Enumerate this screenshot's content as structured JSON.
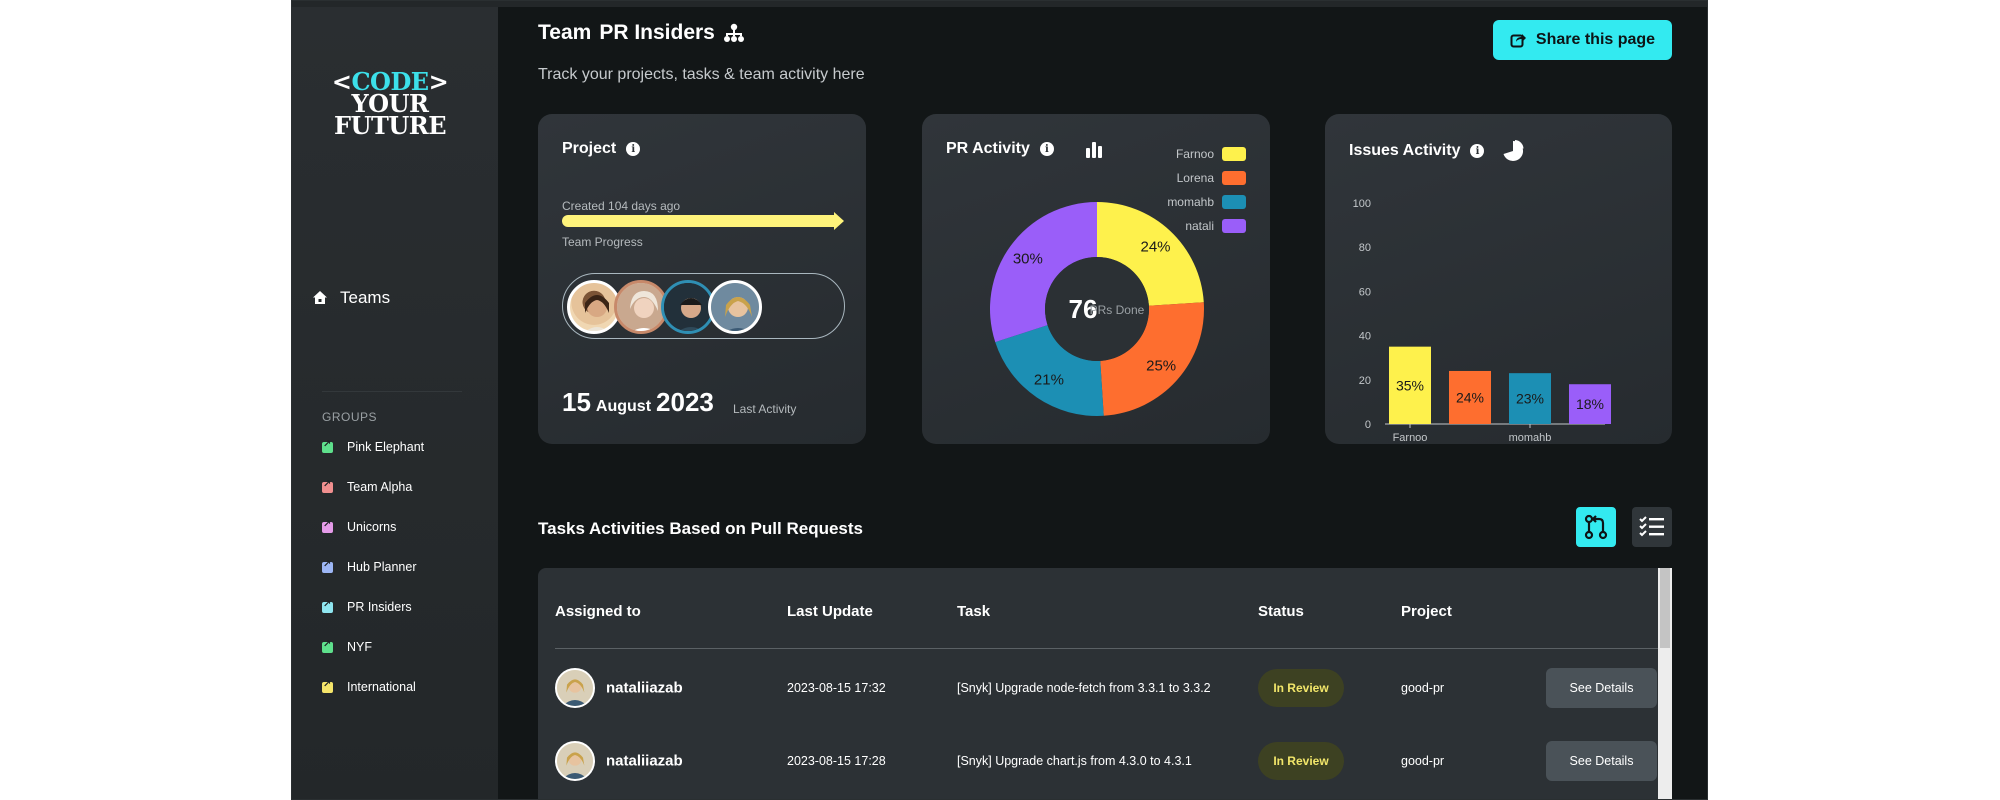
{
  "brand": {
    "logo_lt": "<",
    "logo_code": "CODE",
    "logo_gt": ">",
    "logo_your": "YOUR",
    "logo_future": "FUTURE"
  },
  "sidebar": {
    "teams_label": "Teams",
    "groups_title": "GROUPS",
    "groups": [
      {
        "label": "Pink Elephant",
        "color": "#5ee08c"
      },
      {
        "label": "Team Alpha",
        "color": "#f08f8f"
      },
      {
        "label": "Unicorns",
        "color": "#e59be9"
      },
      {
        "label": "Hub Planner",
        "color": "#9db6f5"
      },
      {
        "label": "PR Insiders",
        "color": "#8fe6f0"
      },
      {
        "label": "NYF",
        "color": "#5ee08c"
      },
      {
        "label": "International",
        "color": "#f5e56a"
      }
    ]
  },
  "header": {
    "title_team": "Team",
    "title_name": "PR Insiders",
    "subtitle": "Track your projects, tasks & team activity here",
    "share_label": "Share this page"
  },
  "project_card": {
    "title": "Project",
    "created": "Created 104 days ago",
    "progress_label": "Team Progress",
    "team_progress": 1.0,
    "date_day": "15",
    "date_month": "August",
    "date_year": "2023",
    "last_activity_label": "Last Activity"
  },
  "pr_card": {
    "title": "PR Activity",
    "center_value": "76",
    "center_label": "PRs Done"
  },
  "issues_card": {
    "title": "Issues Activity"
  },
  "colors": {
    "accent": "#33eaf0",
    "yellow": "#fef14c",
    "orange": "#fe6e2f",
    "blue": "#1c8fb4",
    "purple": "#9a5ef9"
  },
  "chart_data": [
    {
      "type": "pie",
      "title": "PR Activity",
      "categories": [
        "Farnoo",
        "Lorena",
        "momahb",
        "natali"
      ],
      "values": [
        24,
        25,
        21,
        30
      ],
      "labels": [
        "24%",
        "25%",
        "21%",
        "30%"
      ],
      "colors": [
        "#fef14c",
        "#fe6e2f",
        "#1c8fb4",
        "#9a5ef9"
      ],
      "legend": "top-right"
    },
    {
      "type": "bar",
      "title": "Issues Activity",
      "categories": [
        "Farnoo",
        "Lorena",
        "momahb",
        "natali"
      ],
      "x_tick_labels": [
        "Farnoo",
        "momahb"
      ],
      "values": [
        35,
        24,
        23,
        18
      ],
      "labels": [
        "35%",
        "24%",
        "23%",
        "18%"
      ],
      "colors": [
        "#fef14c",
        "#fe6e2f",
        "#1c8fb4",
        "#9a5ef9"
      ],
      "ylim": [
        0,
        100
      ],
      "yticks": [
        "100",
        "80",
        "60",
        "40",
        "20",
        "0"
      ]
    }
  ],
  "tasks": {
    "title": "Tasks Activities Based on Pull Requests",
    "columns": [
      "Assigned to",
      "Last Update",
      "Task",
      "Status",
      "Project"
    ],
    "rows": [
      {
        "user": "nataliiazab",
        "updated": "2023-08-15 17:32",
        "task": "[Snyk] Upgrade node-fetch from 3.3.1 to 3.3.2",
        "status": "In Review",
        "project": "good-pr",
        "action": "See Details"
      },
      {
        "user": "nataliiazab",
        "updated": "2023-08-15 17:28",
        "task": "[Snyk] Upgrade chart.js from 4.3.0 to 4.3.1",
        "status": "In Review",
        "project": "good-pr",
        "action": "See Details"
      }
    ]
  }
}
